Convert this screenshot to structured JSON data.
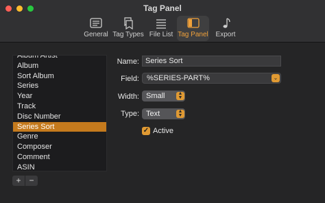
{
  "window": {
    "title": "Tag Panel"
  },
  "toolbar": {
    "tabs": [
      {
        "label": "General",
        "icon": "general-icon"
      },
      {
        "label": "Tag Types",
        "icon": "tag-types-icon"
      },
      {
        "label": "File List",
        "icon": "file-list-icon"
      },
      {
        "label": "Tag Panel",
        "icon": "tag-panel-icon",
        "active": true
      },
      {
        "label": "Export",
        "icon": "export-icon"
      }
    ]
  },
  "list": {
    "items": [
      "Album Artist",
      "Album",
      "Sort Album",
      "Series",
      "Year",
      "Track",
      "Disc Number",
      "Series Sort",
      "Genre",
      "Composer",
      "Comment",
      "ASIN"
    ],
    "selected": "Series Sort",
    "add_label": "+",
    "remove_label": "−"
  },
  "form": {
    "name_label": "Name:",
    "name_value": "Series Sort",
    "field_label": "Field:",
    "field_value": "%SERIES-PART%",
    "width_label": "Width:",
    "width_value": "Small",
    "type_label": "Type:",
    "type_value": "Text",
    "active_label": "Active",
    "active_checked": true
  },
  "colors": {
    "accent": "#e09a33",
    "selection": "#c57a1d"
  }
}
